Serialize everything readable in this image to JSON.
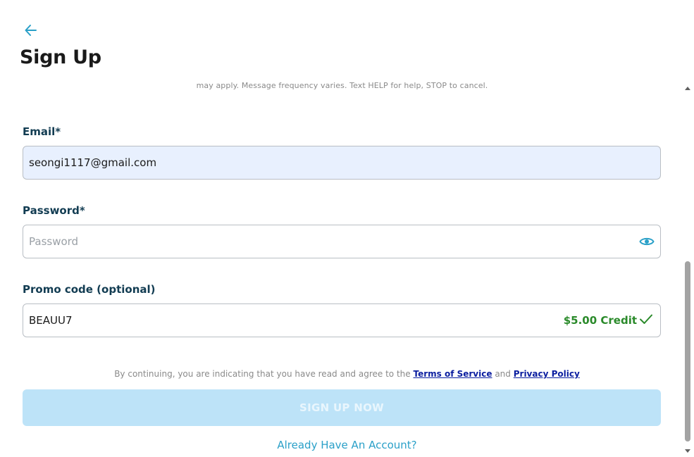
{
  "header": {
    "title": "Sign Up",
    "back_icon": "arrow-left-icon"
  },
  "sms_note": "may apply. Message frequency varies. Text HELP for help, STOP to cancel.",
  "email": {
    "label": "Email*",
    "value": "seongi1117@gmail.com"
  },
  "password": {
    "label": "Password*",
    "placeholder": "Password",
    "toggle_icon": "eye-icon"
  },
  "promo": {
    "label": "Promo code (optional)",
    "value": "BEAUU7",
    "status": "$5.00 Credit",
    "status_icon": "checkmark-icon"
  },
  "terms": {
    "prefix": "By continuing, you are indicating that you have read and agree to the",
    "tos_link": "Terms of Service",
    "conjunction": "and",
    "privacy_link": "Privacy Policy"
  },
  "signup_button": "SIGN UP NOW",
  "login_link": "Already Have An Account?",
  "colors": {
    "accent": "#2aa0c8",
    "label": "#123c52",
    "success": "#2a8a2a",
    "button_disabled": "#bde3f8",
    "autofill_bg": "#e8f0fe"
  }
}
